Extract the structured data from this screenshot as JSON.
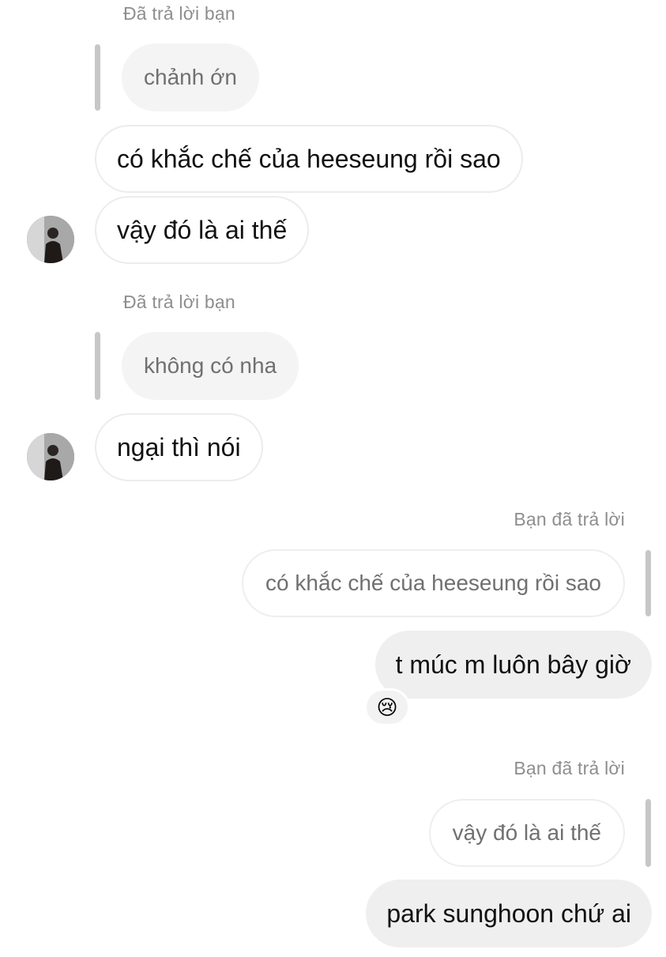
{
  "thread": {
    "block1": {
      "meta": "Đã trả lời bạn",
      "quoted": "chảnh ớn",
      "messages": [
        "có khắc chế của heeseung rồi sao",
        "vậy đó là ai thế"
      ]
    },
    "block2": {
      "meta": "Đã trả lời bạn",
      "quoted": "không có nha",
      "messages": [
        "ngại thì nói"
      ]
    },
    "block3": {
      "meta": "Bạn đã trả lời",
      "quoted": "có khắc chế của heeseung rồi sao",
      "messages": [
        "t múc m luôn bây giờ"
      ],
      "reaction": "😢"
    },
    "block4": {
      "meta": "Bạn đã trả lời",
      "quoted": "vậy đó là ai thế",
      "messages": [
        "park sunghoon chứ ai"
      ]
    }
  },
  "icons": {
    "avatar": "profile-photo",
    "reaction": "crying-face-emoji"
  },
  "colors": {
    "background": "#ffffff",
    "meta_text": "#8e8e8e",
    "reply_bar": "#c7c7c7",
    "incoming_border": "#ececec",
    "outgoing_bubble": "#efefef"
  }
}
